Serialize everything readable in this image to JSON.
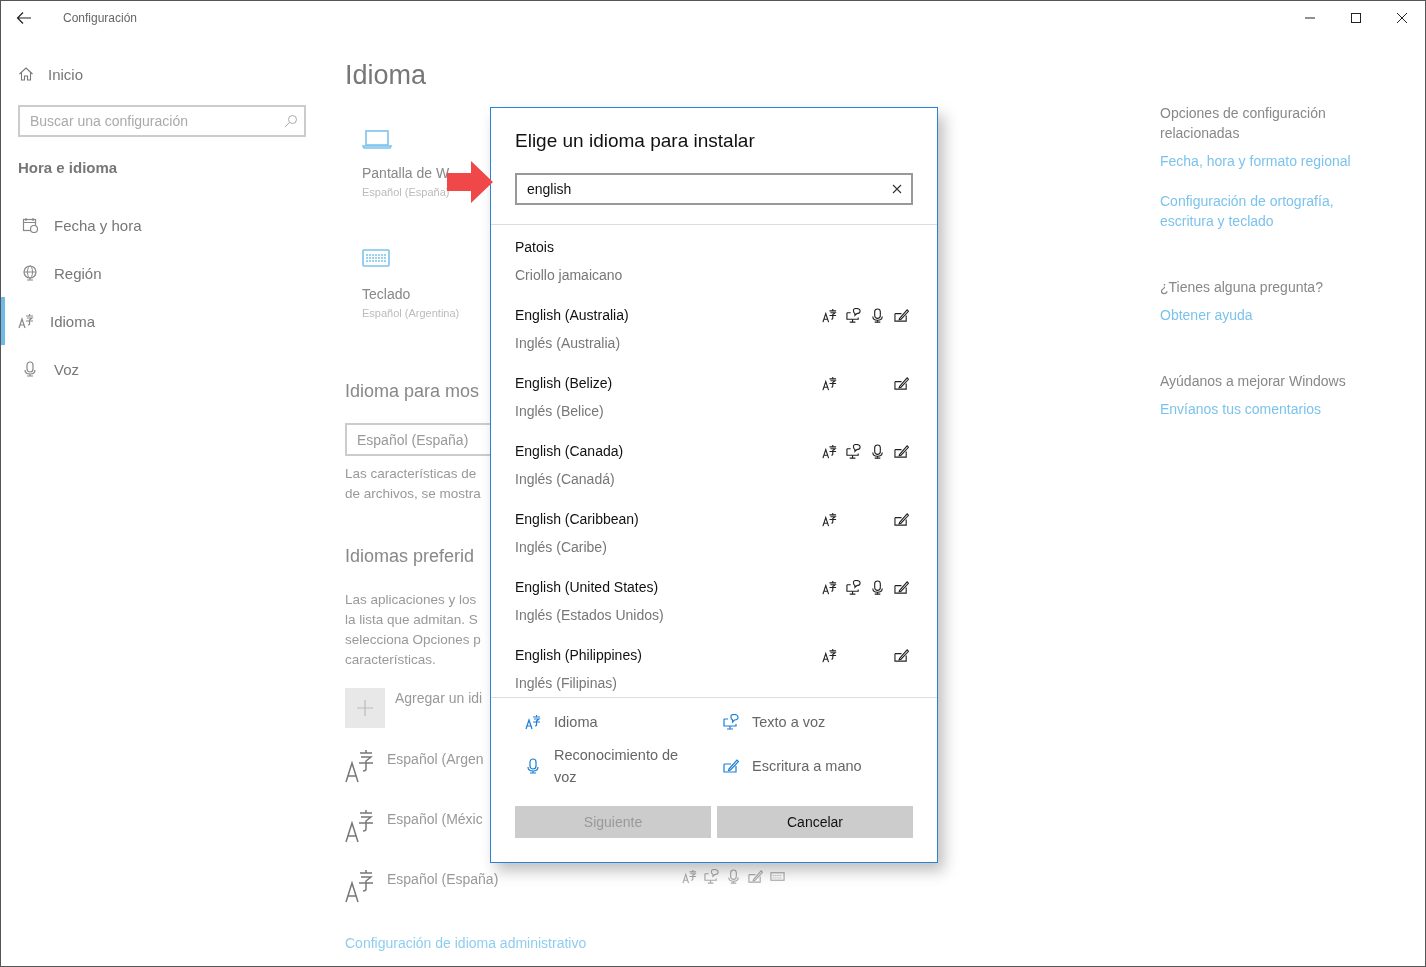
{
  "window": {
    "title": "Configuración"
  },
  "sidebar": {
    "home": "Inicio",
    "search": {
      "placeholder": "Buscar una configuración"
    },
    "section": "Hora e idioma",
    "items": [
      {
        "kind": "calendar",
        "label": "Fecha y hora",
        "selected": false
      },
      {
        "kind": "globe",
        "label": "Región",
        "selected": false
      },
      {
        "kind": "language",
        "label": "Idioma",
        "selected": true
      },
      {
        "kind": "mic",
        "label": "Voz",
        "selected": false
      }
    ]
  },
  "main": {
    "title": "Idioma",
    "cards": [
      {
        "kind": "display",
        "title": "Pantalla de W",
        "subtitle": "Español (España)"
      },
      {
        "kind": "keyboard",
        "title": "Teclado",
        "subtitle": "Español (Argentina)"
      }
    ],
    "display_language": {
      "heading": "Idioma para mos",
      "value": "Español (España)",
      "note": "Las características de\nde archivos, se mostra"
    },
    "preferred": {
      "heading": "Idiomas preferid",
      "note": "Las aplicaciones y los\nla lista que admitan. S\nselecciona Opciones p\ncaracterísticas.",
      "add_label": "Agregar un idi",
      "languages": [
        {
          "name": "Español (Argen"
        },
        {
          "name": "Español (Méxic"
        },
        {
          "name": "Español (España)",
          "features": {
            "language": true,
            "tts": true,
            "speech": true,
            "handwriting": true,
            "keyboard": true
          }
        }
      ]
    },
    "admin_link": "Configuración de idioma administrativo"
  },
  "related": {
    "sections": [
      {
        "heading": "Opciones de configuración relacionadas",
        "links": [
          "Fecha, hora y formato regional",
          "Configuración de ortografía, escritura y teclado"
        ]
      },
      {
        "heading": "¿Tienes alguna pregunta?",
        "links": [
          "Obtener ayuda"
        ]
      },
      {
        "heading": "Ayúdanos a mejorar Windows",
        "links": [
          "Envíanos tus comentarios"
        ]
      }
    ]
  },
  "dialog": {
    "title": "Elige un idioma para instalar",
    "search": {
      "value": "english"
    },
    "languages": [
      {
        "name": "Patois",
        "native": "Criollo jamaicano",
        "features": {
          "language": false,
          "tts": false,
          "speech": false,
          "handwriting": false
        }
      },
      {
        "name": "English (Australia)",
        "native": "Inglés (Australia)",
        "features": {
          "language": true,
          "tts": true,
          "speech": true,
          "handwriting": true
        }
      },
      {
        "name": "English (Belize)",
        "native": "Inglés (Belice)",
        "features": {
          "language": true,
          "tts": false,
          "speech": false,
          "handwriting": true
        }
      },
      {
        "name": "English (Canada)",
        "native": "Inglés (Canadá)",
        "features": {
          "language": true,
          "tts": true,
          "speech": true,
          "handwriting": true
        }
      },
      {
        "name": "English (Caribbean)",
        "native": "Inglés (Caribe)",
        "features": {
          "language": true,
          "tts": false,
          "speech": false,
          "handwriting": true
        }
      },
      {
        "name": "English (United States)",
        "native": "Inglés (Estados Unidos)",
        "features": {
          "language": true,
          "tts": true,
          "speech": true,
          "handwriting": true
        }
      },
      {
        "name": "English (Philippines)",
        "native": "Inglés (Filipinas)",
        "features": {
          "language": true,
          "tts": false,
          "speech": false,
          "handwriting": true
        }
      }
    ],
    "legend": [
      {
        "kind": "language",
        "label": "Idioma"
      },
      {
        "kind": "tts",
        "label": "Texto a voz"
      },
      {
        "kind": "speech",
        "label": "Reconocimiento de voz"
      },
      {
        "kind": "handwriting",
        "label": "Escritura a mano"
      }
    ],
    "buttons": [
      {
        "label": "Siguiente",
        "disabled": true
      },
      {
        "label": "Cancelar",
        "disabled": false
      }
    ]
  }
}
